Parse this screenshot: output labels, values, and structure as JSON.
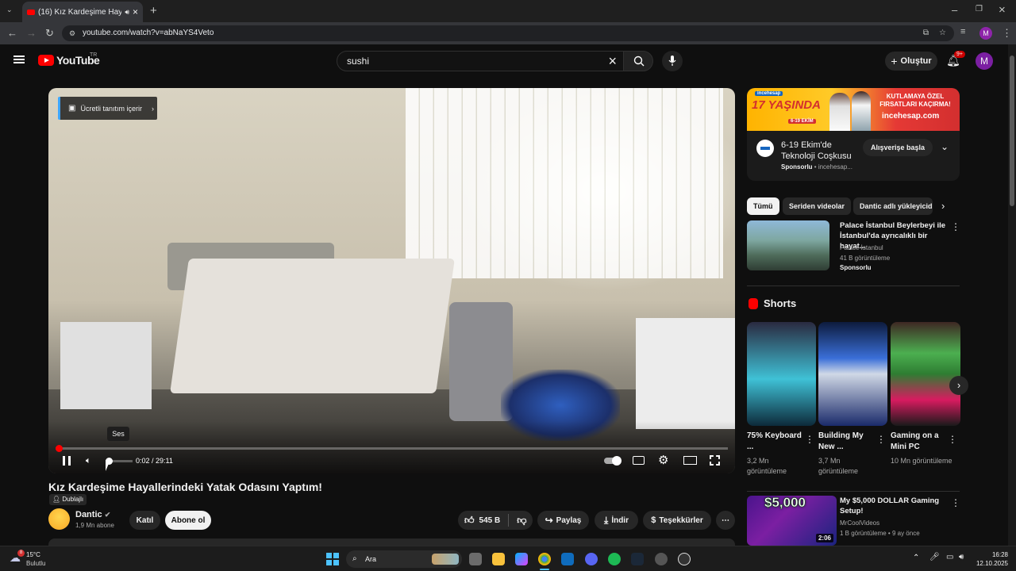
{
  "browser": {
    "tab_title": "(16) Kız Kardeşime Hayaller",
    "url": "youtube.com/watch?v=abNaYS4Veto",
    "profile_initial": "M"
  },
  "youtube": {
    "logo_text": "YouTube",
    "region": "TR",
    "search_value": "sushi",
    "create_label": "Oluştur",
    "notif_badge": "9+",
    "avatar_initial": "M"
  },
  "player": {
    "paid_promo": "Ücretli tanıtım içerir",
    "time": "0:02 / 29:11",
    "progress_fraction": 0.0011,
    "tooltip": "Ses"
  },
  "video": {
    "title": "Kız Kardeşime Hayallerindeki Yatak Odasını Yaptım!",
    "dub_badge": "Dublajlı",
    "channel": "Dantic",
    "subscribers": "1,9 Mn abone",
    "join_label": "Katıl",
    "subscribe_label": "Abone ol",
    "likes": "545 B",
    "share_label": "Paylaş",
    "download_label": "İndir",
    "thanks_label": "Teşekkürler"
  },
  "ad": {
    "banner_brand": "incehesap",
    "banner_left": "17 YAŞINDA",
    "banner_dates": "6-19 EKİM",
    "banner_right": "KUTLAMAYA ÖZEL FIRSATLARI KAÇIRMA!",
    "banner_domain": "incehesap.com",
    "title": "6-19 Ekim'de Teknoloji Coşkusu",
    "sponsor": "Sponsorlu",
    "advertiser": "incehesap...",
    "cta": "Alışverişe başla"
  },
  "chips": [
    "Tümü",
    "Seriden videolar",
    "Dantic adlı yükleyicid"
  ],
  "sponsored_video": {
    "title": "Palace İstanbul Beylerbeyi ile İstanbul'da ayrıcalıklı bir hayat...",
    "channel": "Palace İstanbul",
    "views": "41 B görüntüleme",
    "sponsored": "Sponsorlu"
  },
  "shorts": {
    "heading": "Shorts",
    "items": [
      {
        "title": "75% Keyboard ...",
        "views": "3,2 Mn görüntüleme",
        "color": "#1e88e5"
      },
      {
        "title": "Building My New ...",
        "views": "3,7 Mn görüntüleme",
        "color": "#3949ab"
      },
      {
        "title": "Gaming on a Mini PC",
        "views": "10 Mn görüntüleme",
        "color": "#2e7d32"
      }
    ]
  },
  "next_video": {
    "thumb_text": "$5,000",
    "duration": "2:06",
    "title": "My $5,000 DOLLAR Gaming Setup!",
    "channel": "MrCoolVideos",
    "meta": "1 B görüntüleme • 9 ay önce"
  },
  "taskbar": {
    "temp": "15°C",
    "weather": "Bulutlu",
    "weather_badge": "8",
    "search_label": "Ara",
    "time": "16:28",
    "date": "12.10.2025"
  }
}
